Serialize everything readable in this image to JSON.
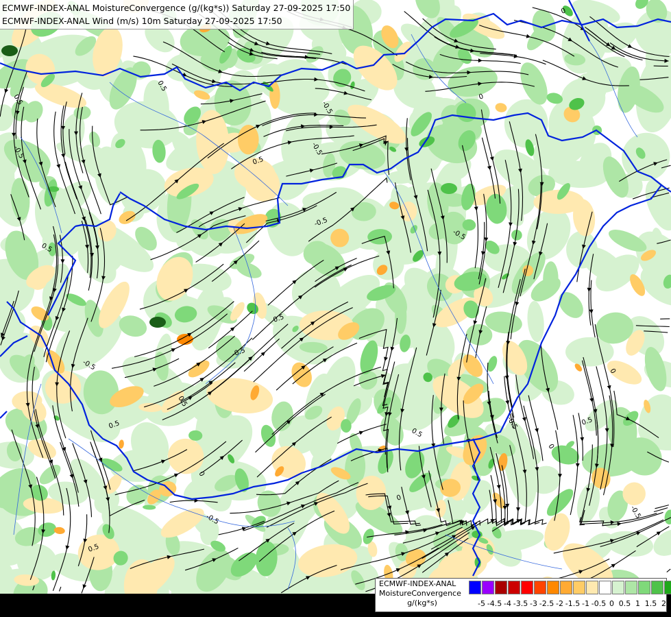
{
  "header": {
    "line1": "ECMWF-INDEX-ANAL MoistureConvergence (g/(kg*s)) Saturday 27-09-2025 17:50",
    "line2": "ECMWF-INDEX-ANAL Wind (m/s) 10m Saturday 27-09-2025 17:50"
  },
  "legend": {
    "line1": "ECMWF-INDEX-ANAL",
    "line2": "MoistureConvergence",
    "unit": "g/(kg*s)",
    "colors": [
      "#0000ff",
      "#9900ff",
      "#aa0000",
      "#cc0000",
      "#ff0000",
      "#ff4400",
      "#ff8800",
      "#ffaa33",
      "#ffcc66",
      "#ffe9b0",
      "#ffffff",
      "#d6f2d0",
      "#aee6a6",
      "#7fd97a",
      "#4fc24a",
      "#1fa81a"
    ],
    "tick_labels": [
      "-5",
      "-4.5",
      "-4",
      "-3.5",
      "-3",
      "-2.5",
      "-2",
      "-1.5",
      "-1",
      "-0.5",
      "0",
      "0.5",
      "1",
      "1.5",
      "2"
    ]
  },
  "contour_labels": [
    "-0.5",
    "0.5",
    "0",
    "-0.5",
    "0.5",
    "0",
    "-0.5",
    "0.5",
    "-0.5",
    "0.5",
    "-0.5",
    "0.5",
    "-0.5",
    "0.5",
    "0",
    "-0.5",
    "0.5",
    "0",
    "-0.5",
    "0.5",
    "-0.5",
    "0.5",
    "0",
    "-0.5",
    "0.5",
    "0"
  ],
  "colors": {
    "border": "#0022dd",
    "river": "#2255dd",
    "streamline": "#000000",
    "bottom_band": "#000000"
  }
}
